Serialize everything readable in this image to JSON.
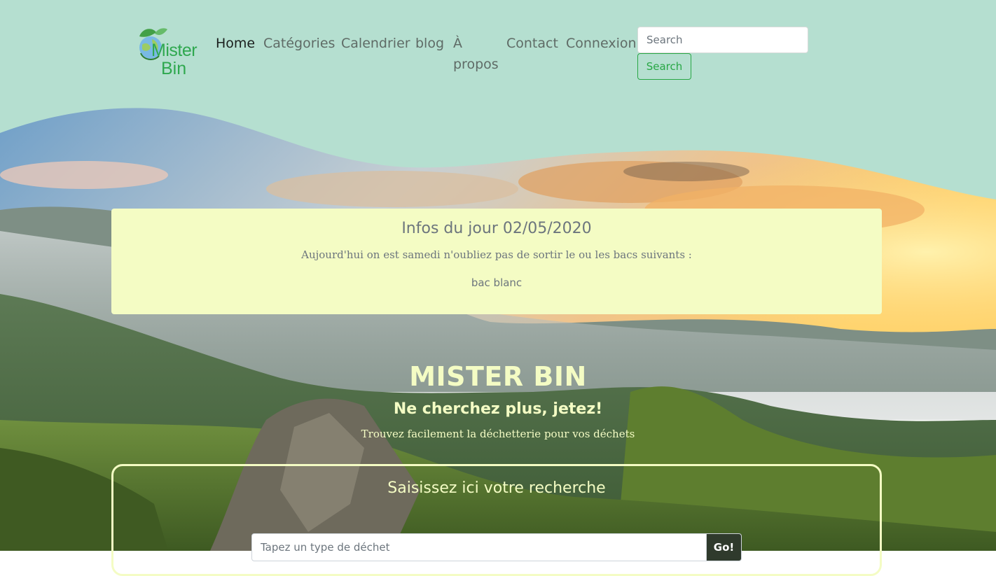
{
  "colors": {
    "header_bg": "#b5dfd0",
    "accent_green": "#28a745",
    "card_bg": "#f4fcc4",
    "hero_text": "#f4fcc4"
  },
  "brand": {
    "logo_line1": "Mister",
    "logo_line2": "Bin",
    "logo_icon": "leaf-globe-icon"
  },
  "nav": {
    "items": [
      {
        "label": "Home",
        "active": true
      },
      {
        "label": "Catégories"
      },
      {
        "label": "Calendrier"
      },
      {
        "label": "blog"
      },
      {
        "label": "À propos"
      },
      {
        "label": "Contact"
      },
      {
        "label": "Connexion"
      }
    ],
    "search_placeholder": "Search",
    "search_button": "Search"
  },
  "info": {
    "title": "Infos du jour 02/05/2020",
    "text": "Aujourd'hui on est samedi n'oubliez pas de sortir le ou les bacs suivants :",
    "bins": [
      "bac blanc"
    ]
  },
  "hero": {
    "title": "MISTER BIN",
    "subtitle": "Ne cherchez plus, jetez!",
    "text": "Trouvez facilement la déchetterie pour vos déchets"
  },
  "waste_search": {
    "title": "Saisissez ici votre recherche",
    "placeholder": "Tapez un type de déchet",
    "button": "Go!"
  }
}
